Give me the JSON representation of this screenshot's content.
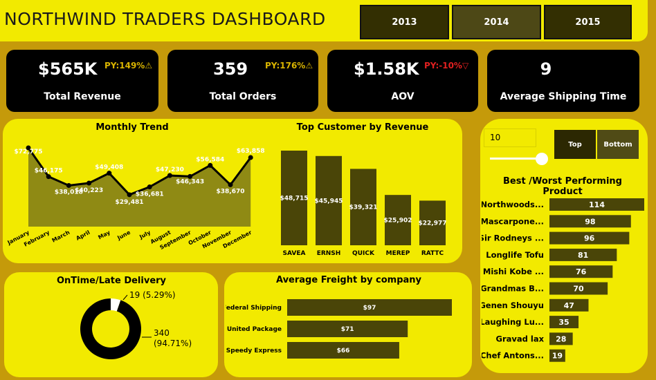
{
  "header": {
    "title": "NORTHWIND TRADERS DASHBOARD",
    "years": [
      "2013",
      "2014",
      "2015"
    ]
  },
  "colors": {
    "background": "#c59a0a",
    "panel": "#f2ea00",
    "bar": "#4a4508",
    "area": "#8f8a14",
    "up": "#d9b400",
    "down": "#e02020"
  },
  "kpis": [
    {
      "value": "$565K",
      "py": "PY:149%",
      "py_icon": "warning-triangle-icon",
      "label": "Total Revenue"
    },
    {
      "value": "359",
      "py": "PY:176%",
      "py_icon": "warning-triangle-icon",
      "label": "Total Orders"
    },
    {
      "value": "$1.58K",
      "py": "PY:-10%",
      "py_icon": "down-triangle-icon",
      "label": "AOV"
    },
    {
      "value": "9",
      "py": "",
      "label": "Average Shipping Time"
    }
  ],
  "chart_data": [
    {
      "type": "area",
      "title": "Monthly Trend",
      "categories": [
        "January",
        "February",
        "March",
        "April",
        "May",
        "June",
        "July",
        "August",
        "September",
        "October",
        "November",
        "December"
      ],
      "values": [
        72775,
        46175,
        38018,
        40223,
        49408,
        29481,
        36681,
        47230,
        46343,
        56584,
        38670,
        63858
      ],
      "labels": [
        "$72,775",
        "$46,175",
        "$38,018",
        "$40,223",
        "$49,408",
        "$29,481",
        "$36,681",
        "$47,230",
        "$46,343",
        "$56,584",
        "$38,670",
        "$63,858"
      ]
    },
    {
      "type": "bar",
      "title": "Top Customer by Revenue",
      "categories": [
        "SAVEA",
        "ERNSH",
        "QUICK",
        "MEREP",
        "RATTC"
      ],
      "values": [
        48715,
        45945,
        39321,
        25902,
        22977
      ],
      "labels": [
        "$48,715",
        "$45,945",
        "$39,321",
        "$25,902",
        "$22,977"
      ]
    },
    {
      "type": "pie",
      "title": "OnTime/Late Delivery",
      "values": [
        340,
        19
      ],
      "labels": [
        "340",
        "19 (5.29%)"
      ],
      "percents": [
        "(94.71%)",
        ""
      ]
    },
    {
      "type": "bar",
      "title": "Average Freight by company",
      "categories": [
        "Federal Shipping",
        "United Package",
        "Speedy Express"
      ],
      "values": [
        97,
        71,
        66
      ],
      "labels": [
        "$97",
        "$71",
        "$66"
      ]
    },
    {
      "type": "bar",
      "title": "Best /Worst Performing Product",
      "categories": [
        "Northwoods...",
        "Mascarpone...",
        "Sir Rodneys ...",
        "Longlife Tofu",
        "Mishi Kobe ...",
        "Grandmas B...",
        "Genen Shouyu",
        "Laughing Lu...",
        "Gravad lax",
        "Chef Antons..."
      ],
      "values": [
        114,
        98,
        96,
        81,
        76,
        70,
        47,
        35,
        28,
        19
      ]
    }
  ],
  "controls": {
    "topn_value": "10",
    "slider_level": 1.0,
    "top_label": "Top",
    "bottom_label": "Bottom"
  }
}
